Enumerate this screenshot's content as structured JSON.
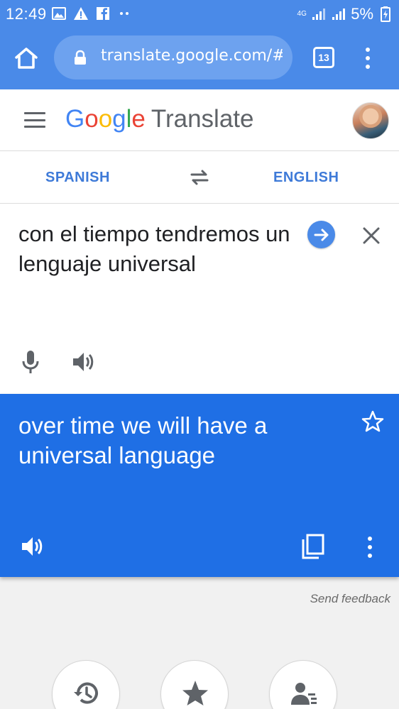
{
  "status_bar": {
    "time": "12:49",
    "network_label": "4G",
    "battery_text": "5%"
  },
  "browser": {
    "url": "translate.google.com/#v",
    "tab_count": "13"
  },
  "app": {
    "logo_letters": [
      "G",
      "o",
      "o",
      "g",
      "l",
      "e"
    ],
    "product_name": "Translate"
  },
  "languages": {
    "source": "SPANISH",
    "target": "ENGLISH"
  },
  "source_panel": {
    "text": "con el tiempo tendremos un lenguaje universal"
  },
  "result_panel": {
    "text": "over time we will have a universal language"
  },
  "feedback_link": "Send feedback",
  "colors": {
    "browser_blue": "#4a8ae8",
    "result_blue": "#1f6fe5",
    "language_blue": "#3e7ad8"
  },
  "icons": [
    "home-icon",
    "lock-icon",
    "tabs-icon",
    "more-vert-icon",
    "menu-icon",
    "swap-icon",
    "arrow-forward-icon",
    "close-icon",
    "mic-icon",
    "volume-icon",
    "star-icon",
    "copy-icon",
    "history-icon",
    "saved-star-icon",
    "community-icon"
  ]
}
